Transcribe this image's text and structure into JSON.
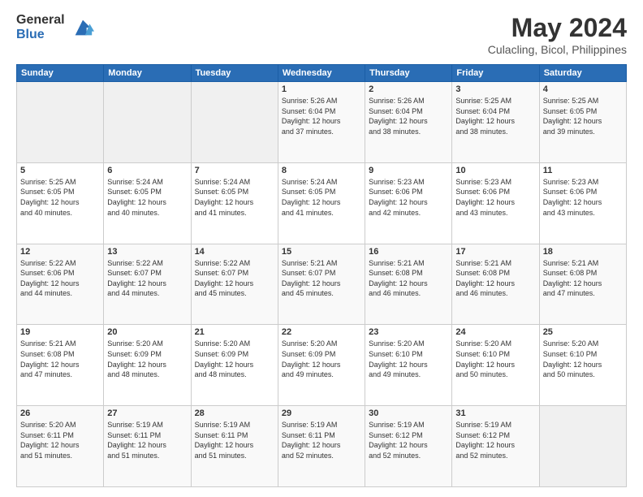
{
  "header": {
    "logo_general": "General",
    "logo_blue": "Blue",
    "title": "May 2024",
    "location": "Culacling, Bicol, Philippines"
  },
  "days_of_week": [
    "Sunday",
    "Monday",
    "Tuesday",
    "Wednesday",
    "Thursday",
    "Friday",
    "Saturday"
  ],
  "weeks": [
    [
      {
        "day": "",
        "info": ""
      },
      {
        "day": "",
        "info": ""
      },
      {
        "day": "",
        "info": ""
      },
      {
        "day": "1",
        "info": "Sunrise: 5:26 AM\nSunset: 6:04 PM\nDaylight: 12 hours\nand 37 minutes."
      },
      {
        "day": "2",
        "info": "Sunrise: 5:26 AM\nSunset: 6:04 PM\nDaylight: 12 hours\nand 38 minutes."
      },
      {
        "day": "3",
        "info": "Sunrise: 5:25 AM\nSunset: 6:04 PM\nDaylight: 12 hours\nand 38 minutes."
      },
      {
        "day": "4",
        "info": "Sunrise: 5:25 AM\nSunset: 6:05 PM\nDaylight: 12 hours\nand 39 minutes."
      }
    ],
    [
      {
        "day": "5",
        "info": "Sunrise: 5:25 AM\nSunset: 6:05 PM\nDaylight: 12 hours\nand 40 minutes."
      },
      {
        "day": "6",
        "info": "Sunrise: 5:24 AM\nSunset: 6:05 PM\nDaylight: 12 hours\nand 40 minutes."
      },
      {
        "day": "7",
        "info": "Sunrise: 5:24 AM\nSunset: 6:05 PM\nDaylight: 12 hours\nand 41 minutes."
      },
      {
        "day": "8",
        "info": "Sunrise: 5:24 AM\nSunset: 6:05 PM\nDaylight: 12 hours\nand 41 minutes."
      },
      {
        "day": "9",
        "info": "Sunrise: 5:23 AM\nSunset: 6:06 PM\nDaylight: 12 hours\nand 42 minutes."
      },
      {
        "day": "10",
        "info": "Sunrise: 5:23 AM\nSunset: 6:06 PM\nDaylight: 12 hours\nand 43 minutes."
      },
      {
        "day": "11",
        "info": "Sunrise: 5:23 AM\nSunset: 6:06 PM\nDaylight: 12 hours\nand 43 minutes."
      }
    ],
    [
      {
        "day": "12",
        "info": "Sunrise: 5:22 AM\nSunset: 6:06 PM\nDaylight: 12 hours\nand 44 minutes."
      },
      {
        "day": "13",
        "info": "Sunrise: 5:22 AM\nSunset: 6:07 PM\nDaylight: 12 hours\nand 44 minutes."
      },
      {
        "day": "14",
        "info": "Sunrise: 5:22 AM\nSunset: 6:07 PM\nDaylight: 12 hours\nand 45 minutes."
      },
      {
        "day": "15",
        "info": "Sunrise: 5:21 AM\nSunset: 6:07 PM\nDaylight: 12 hours\nand 45 minutes."
      },
      {
        "day": "16",
        "info": "Sunrise: 5:21 AM\nSunset: 6:08 PM\nDaylight: 12 hours\nand 46 minutes."
      },
      {
        "day": "17",
        "info": "Sunrise: 5:21 AM\nSunset: 6:08 PM\nDaylight: 12 hours\nand 46 minutes."
      },
      {
        "day": "18",
        "info": "Sunrise: 5:21 AM\nSunset: 6:08 PM\nDaylight: 12 hours\nand 47 minutes."
      }
    ],
    [
      {
        "day": "19",
        "info": "Sunrise: 5:21 AM\nSunset: 6:08 PM\nDaylight: 12 hours\nand 47 minutes."
      },
      {
        "day": "20",
        "info": "Sunrise: 5:20 AM\nSunset: 6:09 PM\nDaylight: 12 hours\nand 48 minutes."
      },
      {
        "day": "21",
        "info": "Sunrise: 5:20 AM\nSunset: 6:09 PM\nDaylight: 12 hours\nand 48 minutes."
      },
      {
        "day": "22",
        "info": "Sunrise: 5:20 AM\nSunset: 6:09 PM\nDaylight: 12 hours\nand 49 minutes."
      },
      {
        "day": "23",
        "info": "Sunrise: 5:20 AM\nSunset: 6:10 PM\nDaylight: 12 hours\nand 49 minutes."
      },
      {
        "day": "24",
        "info": "Sunrise: 5:20 AM\nSunset: 6:10 PM\nDaylight: 12 hours\nand 50 minutes."
      },
      {
        "day": "25",
        "info": "Sunrise: 5:20 AM\nSunset: 6:10 PM\nDaylight: 12 hours\nand 50 minutes."
      }
    ],
    [
      {
        "day": "26",
        "info": "Sunrise: 5:20 AM\nSunset: 6:11 PM\nDaylight: 12 hours\nand 51 minutes."
      },
      {
        "day": "27",
        "info": "Sunrise: 5:19 AM\nSunset: 6:11 PM\nDaylight: 12 hours\nand 51 minutes."
      },
      {
        "day": "28",
        "info": "Sunrise: 5:19 AM\nSunset: 6:11 PM\nDaylight: 12 hours\nand 51 minutes."
      },
      {
        "day": "29",
        "info": "Sunrise: 5:19 AM\nSunset: 6:11 PM\nDaylight: 12 hours\nand 52 minutes."
      },
      {
        "day": "30",
        "info": "Sunrise: 5:19 AM\nSunset: 6:12 PM\nDaylight: 12 hours\nand 52 minutes."
      },
      {
        "day": "31",
        "info": "Sunrise: 5:19 AM\nSunset: 6:12 PM\nDaylight: 12 hours\nand 52 minutes."
      },
      {
        "day": "",
        "info": ""
      }
    ]
  ]
}
